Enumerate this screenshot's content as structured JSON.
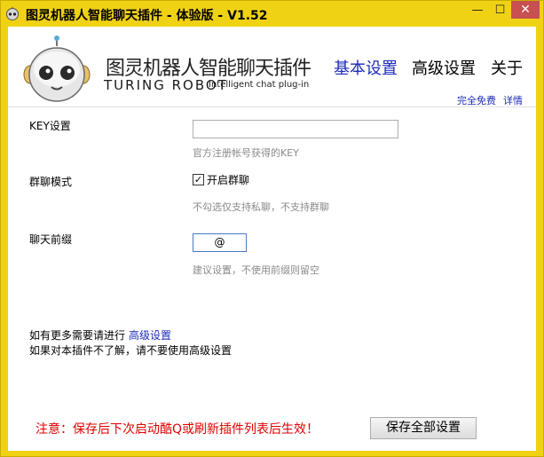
{
  "window": {
    "title": "图灵机器人智能聊天插件 - 体验版 - V1.52",
    "minimize_glyph": "—",
    "maximize_glyph": "☐",
    "close_glyph": "✕",
    "title_bar_color": "#f0d214"
  },
  "header": {
    "logo_cn": "图灵机器人智能聊天插件",
    "logo_en": "TURING ROBOT",
    "logo_subtitle": "Intelligent chat plug-in",
    "nav": {
      "basic": "基本设置",
      "advanced": "高级设置",
      "about": "关于"
    },
    "free_tag": "完全免费",
    "detail_link": "详情",
    "accent_color": "#1e2bb8"
  },
  "settings": {
    "key": {
      "label": "KEY设置",
      "value": "",
      "hint": "官方注册帐号获得的KEY"
    },
    "group_chat": {
      "label": "群聊模式",
      "checkbox_label": "开启群聊",
      "checked": true,
      "hint": "不勾选仅支持私聊，不支持群聊"
    },
    "prefix": {
      "label": "聊天前缀",
      "value": "@",
      "hint": "建议设置，不使用前缀则留空"
    }
  },
  "footer_info": {
    "more_text": "如有更多需要请进行",
    "advanced_link": "高级设置",
    "warning_text": "如果对本插件不了解，请不要使用高级设置"
  },
  "notice": {
    "text": "注意：保存后下次启动酷Q或刷新插件列表后生效！",
    "color": "#e00000"
  },
  "save_button": {
    "label": "保存全部设置"
  },
  "icons": {
    "app": "robot-head-icon",
    "logo": "robot-mascot-icon",
    "checkbox": "checkmark-icon"
  }
}
